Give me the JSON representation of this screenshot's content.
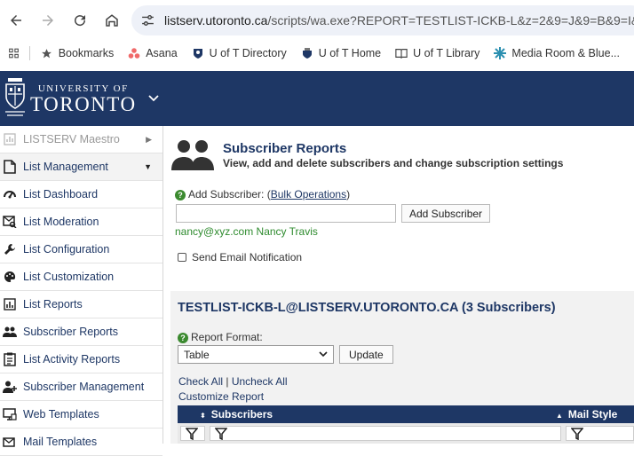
{
  "browser": {
    "url_host": "listserv.utoronto.ca",
    "url_rest": "/scripts/wa.exe?REPORT=TESTLIST-ICKB-L&z=2&9=J&9=B&9=I&9",
    "bookmarks": [
      {
        "label": "Bookmarks",
        "icon": "star-icon"
      },
      {
        "label": "Asana",
        "icon": "asana-icon"
      },
      {
        "label": "U of T Directory",
        "icon": "uoft-crest-icon"
      },
      {
        "label": "U of T Home",
        "icon": "uoft-crest-icon"
      },
      {
        "label": "U of T Library",
        "icon": "library-icon"
      },
      {
        "label": "Media Room & Blue...",
        "icon": "media-icon"
      }
    ]
  },
  "header": {
    "small": "UNIVERSITY OF",
    "big": "TORONTO",
    "bg_color": "#1e3765"
  },
  "sidebar": {
    "items": [
      {
        "label": "LISTSERV Maestro",
        "icon": "bar-chart-icon"
      },
      {
        "label": "List Management",
        "icon": "document-icon"
      },
      {
        "label": "List Dashboard",
        "icon": "dashboard-icon"
      },
      {
        "label": "List Moderation",
        "icon": "moderation-icon"
      },
      {
        "label": "List Configuration",
        "icon": "wrench-icon"
      },
      {
        "label": "List Customization",
        "icon": "palette-icon"
      },
      {
        "label": "List Reports",
        "icon": "reports-icon"
      },
      {
        "label": "Subscriber Reports",
        "icon": "people-icon"
      },
      {
        "label": "List Activity Reports",
        "icon": "activity-icon"
      },
      {
        "label": "Subscriber Management",
        "icon": "add-user-icon"
      },
      {
        "label": "Web Templates",
        "icon": "templates-icon"
      },
      {
        "label": "Mail Templates",
        "icon": "mail-templates-icon"
      }
    ]
  },
  "main": {
    "title": "Subscriber Reports",
    "subtitle": "View, add and delete subscribers and change subscription settings",
    "add_label": "Add Subscriber: (",
    "bulk_link": "Bulk Operations",
    "add_label_close": ")",
    "add_input_value": "",
    "add_button": "Add Subscriber",
    "example": "nancy@xyz.com Nancy Travis",
    "notify_label": "Send Email Notification",
    "report_title": "TESTLIST-ICKB-L@LISTSERV.UTORONTO.CA (3 Subscribers)",
    "format_label": "Report Format:",
    "format_value": "Table",
    "update_button": "Update",
    "check_all": "Check All",
    "check_sep": " | ",
    "uncheck_all": "Uncheck All",
    "customize": "Customize Report",
    "columns": [
      "Subscribers",
      "Mail Style"
    ]
  }
}
